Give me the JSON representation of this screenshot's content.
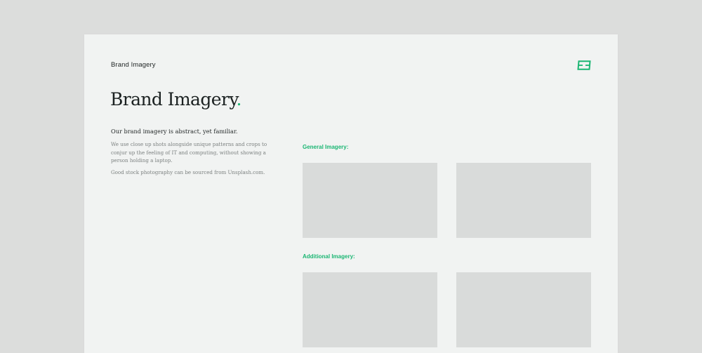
{
  "header": {
    "doc_label": "Brand Imagery",
    "logo_icon": "brand-logo-icon"
  },
  "main": {
    "title": "Brand Imagery",
    "title_dot": ".",
    "lead": "Our brand imagery is abstract, yet familiar.",
    "paragraphs": [
      "We use close up shots alongside unique patterns and crops to conjur up the feeling of IT and computing, without showing a person holding a laptop.",
      "Good stock photography can be sourced from Unsplash.com."
    ]
  },
  "gallery": {
    "sections": [
      {
        "label": "General Imagery:"
      },
      {
        "label": "Additional Imagery:"
      }
    ]
  },
  "colors": {
    "accent": "#1bb673",
    "page": "#f1f3f2",
    "backdrop": "#dcdddc",
    "placeholder": "#d9dbda",
    "text": "#1b2121",
    "muted": "#7c8180"
  }
}
